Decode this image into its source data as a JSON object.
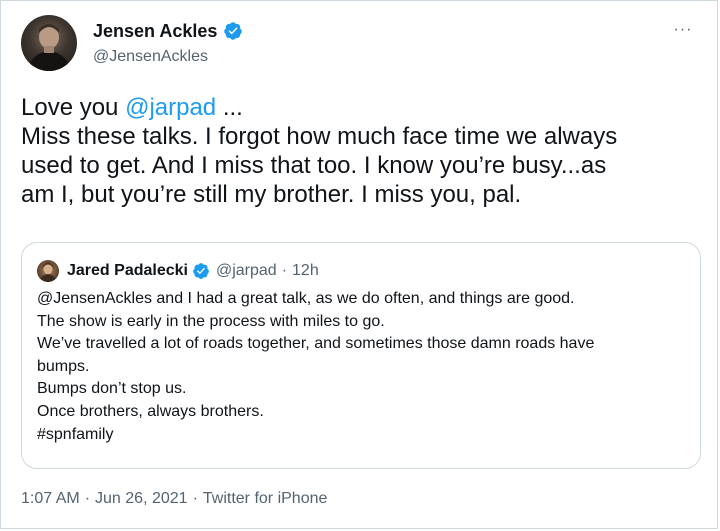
{
  "author": {
    "display_name": "Jensen Ackles",
    "handle": "@JensenAckles",
    "verified_icon": "verified-badge-icon",
    "avatar_icon": "avatar-icon"
  },
  "more_icon": "more-options-icon",
  "more_label": "···",
  "tweet": {
    "lines": [
      {
        "prefix": "Love you ",
        "mention": "@jarpad",
        "suffix": " ..."
      },
      {
        "text": "Miss these talks. I forgot how much face time we always"
      },
      {
        "text": "used to get.  And I miss that too. I know you’re busy...as"
      },
      {
        "text": "am I, but you’re still my brother.  I miss you, pal."
      }
    ]
  },
  "quoted_tweet": {
    "display_name": "Jared Padalecki",
    "handle": "@jarpad",
    "dot": "·",
    "time": "12h",
    "lines": [
      "@JensenAckles and I had a great talk, as we do often, and things are good.",
      "The show is early in the process with miles to go.",
      "We’ve travelled a lot of roads together, and sometimes those damn roads have",
      "bumps.",
      "Bumps don’t stop us.",
      "Once brothers, always brothers.",
      "#spnfamily"
    ]
  },
  "meta": {
    "time": "1:07 AM",
    "sep": "·",
    "date": "Jun 26, 2021",
    "source": "Twitter for iPhone"
  },
  "colors": {
    "accent": "#1d9bf0",
    "text": "#0f1419",
    "secondary": "#536471",
    "border": "#cfd9de"
  }
}
